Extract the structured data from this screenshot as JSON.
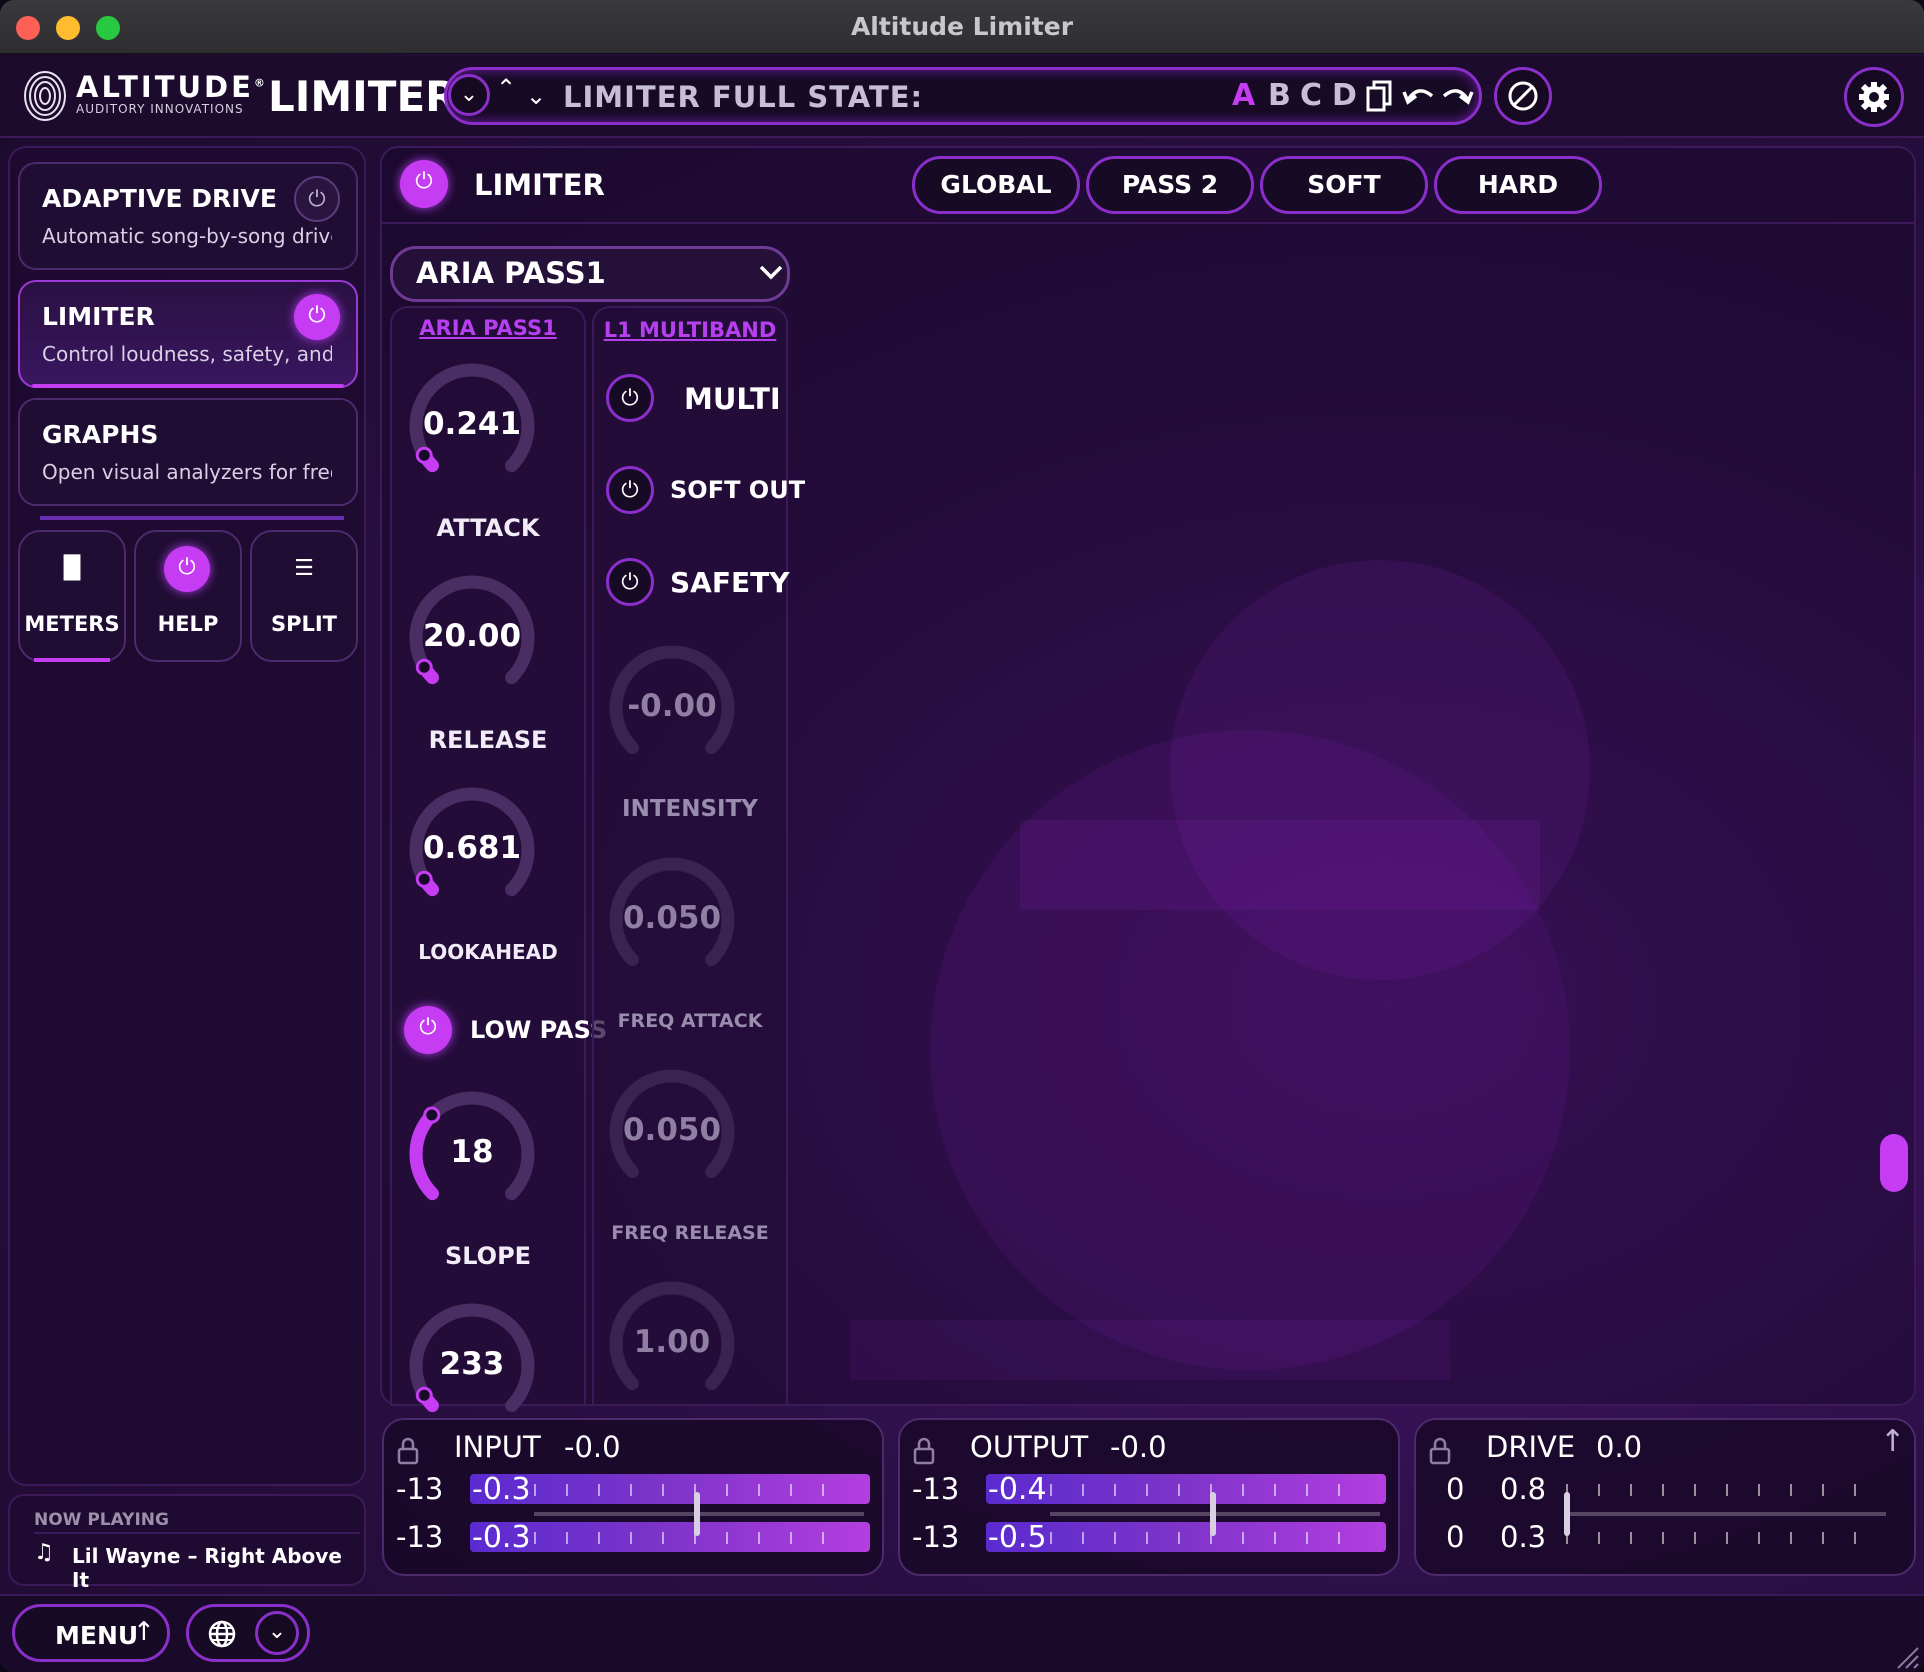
{
  "window": {
    "title": "Altitude Limiter"
  },
  "header": {
    "brand_name": "ALTITUDE",
    "brand_reg": "®",
    "brand_sub": "AUDITORY INNOVATIONS",
    "plugin_name": "LIMITER",
    "state_label": "LIMITER FULL STATE:",
    "slots": [
      "A",
      "B",
      "C",
      "D"
    ],
    "active_slot": "A"
  },
  "sidebar": {
    "modules": [
      {
        "title": "ADAPTIVE DRIVE",
        "subtitle": "Automatic song-by-song drive ...",
        "enabled": false
      },
      {
        "title": "LIMITER",
        "subtitle": "Control loudness, safety, and li...",
        "enabled": true
      },
      {
        "title": "GRAPHS",
        "subtitle": "Open visual analyzers for freque..."
      }
    ],
    "buttons": [
      {
        "label": "METERS",
        "icon": "bar-chart-icon"
      },
      {
        "label": "HELP",
        "icon": "power-icon"
      },
      {
        "label": "SPLIT",
        "icon": "split-icon"
      }
    ],
    "now_playing_label": "NOW PLAYING",
    "now_playing_track": "Lil Wayne – Right Above It"
  },
  "main": {
    "title": "LIMITER",
    "tabs": [
      "GLOBAL",
      "PASS 2",
      "SOFT",
      "HARD"
    ],
    "preset": "ARIA PASS1",
    "col1": {
      "heading": "ARIA PASS1",
      "knobs": [
        {
          "value": "0.241",
          "label": "ATTACK",
          "level": 0.05
        },
        {
          "value": "20.00",
          "label": "RELEASE",
          "level": 0.05
        },
        {
          "value": "0.681",
          "label": "LOOKAHEAD",
          "level": 0.05
        },
        {
          "value": "18",
          "label": "SLOPE",
          "level": 0.33
        },
        {
          "value": "233",
          "label": "",
          "level": 0.05
        }
      ],
      "low_pass_label": "LOW PASS"
    },
    "col2": {
      "heading": "L1 MULTIBAND",
      "switches": [
        "MULTI",
        "SOFT OUT",
        "SAFETY"
      ],
      "knobs": [
        {
          "value": "-0.00",
          "label": "INTENSITY"
        },
        {
          "value": "0.050",
          "label": "FREQ ATTACK"
        },
        {
          "value": "0.050",
          "label": "FREQ RELEASE"
        },
        {
          "value": "1.00",
          "label": ""
        }
      ]
    }
  },
  "meters": [
    {
      "label": "INPUT",
      "value": "-0.0",
      "rows": [
        {
          "left": "-13",
          "val": "-0.3"
        },
        {
          "left": "-13",
          "val": "-0.3"
        }
      ]
    },
    {
      "label": "OUTPUT",
      "value": "-0.0",
      "rows": [
        {
          "left": "-13",
          "val": "-0.4"
        },
        {
          "left": "-13",
          "val": "-0.5"
        }
      ]
    },
    {
      "label": "DRIVE",
      "value": "0.0",
      "rows": [
        {
          "left": "0",
          "val": "0.8"
        },
        {
          "left": "0",
          "val": "0.3"
        }
      ]
    }
  ],
  "bottom": {
    "menu_label": "MENU"
  },
  "colors": {
    "accent": "#c63cf3",
    "border": "#8a2fc9",
    "bg": "#2b0f45"
  }
}
